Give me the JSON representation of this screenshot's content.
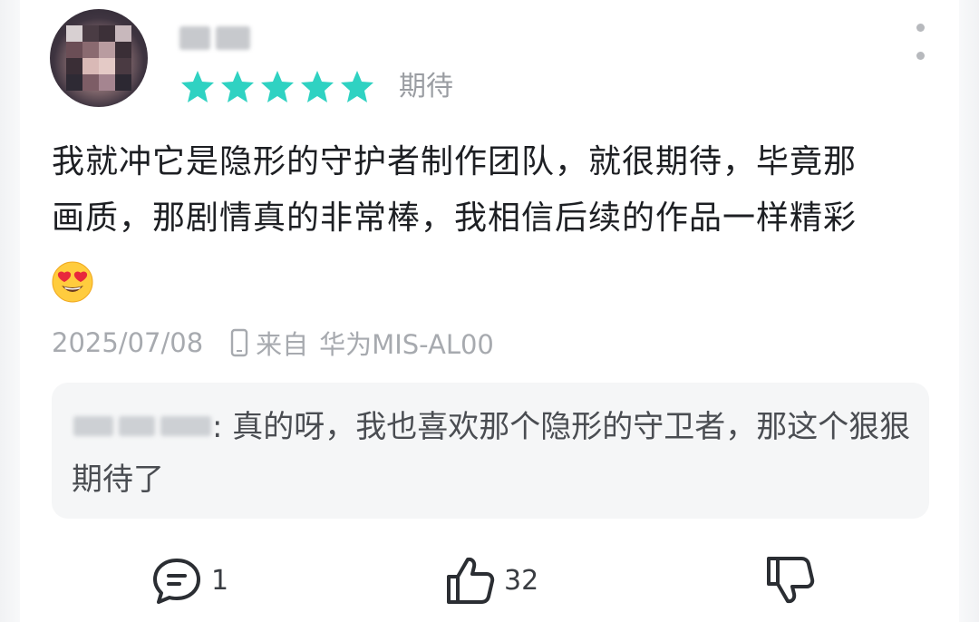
{
  "review": {
    "rating": 5,
    "rating_max": 5,
    "rating_label": "期待",
    "star_color": "#2fd2c2",
    "text_line1": "我就冲它是隐形的守护者制作团队，就很期待，毕竟那",
    "text_line2": "画质，那剧情真的非常棒，我相信后续的作品一样精彩",
    "emoji": "heart-eyes-emoji",
    "date": "2025/07/08",
    "source_prefix": "来自",
    "device": "华为MIS-AL00"
  },
  "reply": {
    "text": ": 真的呀，我也喜欢那个隐形的守卫者，那这个狠狠期待了"
  },
  "actions": {
    "comment_count": "1",
    "like_count": "32"
  },
  "icons": {
    "more": "more-vertical-icon",
    "device": "phone-icon",
    "comment": "comment-icon",
    "like": "thumbs-up-icon",
    "dislike": "thumbs-down-icon"
  }
}
